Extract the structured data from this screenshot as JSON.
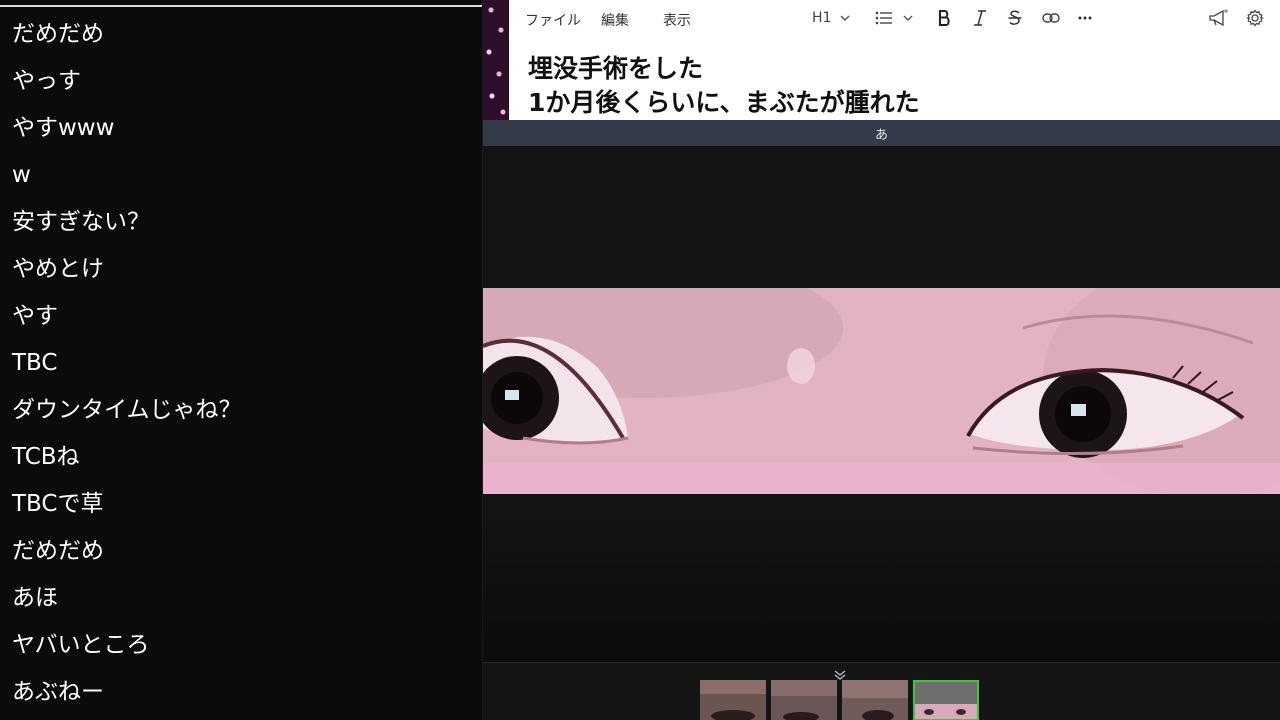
{
  "chat": {
    "messages": [
      "だめだめ",
      "やっす",
      "やすwww",
      "w",
      "安すぎない？",
      "やめとけ",
      "やす",
      "TBC",
      "ダウンタイムじゃね？",
      "TCBね",
      "TBCで草",
      "だめだめ",
      "あほ",
      "ヤバいところ",
      "あぶねー"
    ]
  },
  "editor": {
    "menu": [
      "ファイル",
      "編集",
      "表示"
    ],
    "heading_select": "H1",
    "content_lines": [
      "埋没手術をした",
      "1か月後くらいに、まぶたが腫れた"
    ]
  },
  "divider": {
    "glyph": "あ"
  },
  "icons": {
    "list": "list-icon",
    "bold": "bold-icon",
    "italic": "italic-icon",
    "strike": "strikethrough-icon",
    "link": "link-icon",
    "more": "more-icon",
    "announce": "megaphone-icon",
    "settings": "gear-icon"
  },
  "colors": {
    "thumb_selected": "#39c93b"
  },
  "filmstrip": {
    "thumb_count": 4,
    "selected_index": 3
  }
}
